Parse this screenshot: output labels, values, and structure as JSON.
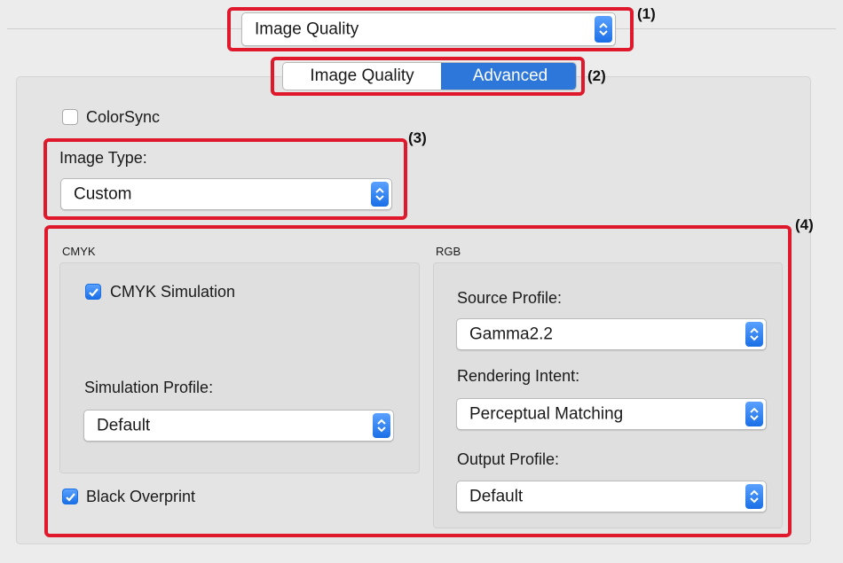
{
  "top_popup": {
    "value": "Image Quality",
    "callout": "(1)"
  },
  "tabs": {
    "items": [
      "Image Quality",
      "Advanced"
    ],
    "selected": "Advanced",
    "callout": "(2)"
  },
  "colorsync": {
    "label": "ColorSync",
    "checked": false
  },
  "image_type": {
    "label": "Image Type:",
    "value": "Custom",
    "callout": "(3)"
  },
  "color_section": {
    "callout": "(4)"
  },
  "cmyk": {
    "title": "CMYK",
    "simulation": {
      "label": "CMYK Simulation",
      "checked": true
    },
    "simulation_profile": {
      "label": "Simulation Profile:",
      "value": "Default"
    }
  },
  "black_overprint": {
    "label": "Black Overprint",
    "checked": true
  },
  "rgb": {
    "title": "RGB",
    "source_profile": {
      "label": "Source Profile:",
      "value": "Gamma2.2"
    },
    "rendering_intent": {
      "label": "Rendering Intent:",
      "value": "Perceptual Matching"
    },
    "output_profile": {
      "label": "Output Profile:",
      "value": "Default"
    }
  },
  "colors": {
    "accent": "#1a6fe6",
    "annotation": "#e0182c"
  }
}
